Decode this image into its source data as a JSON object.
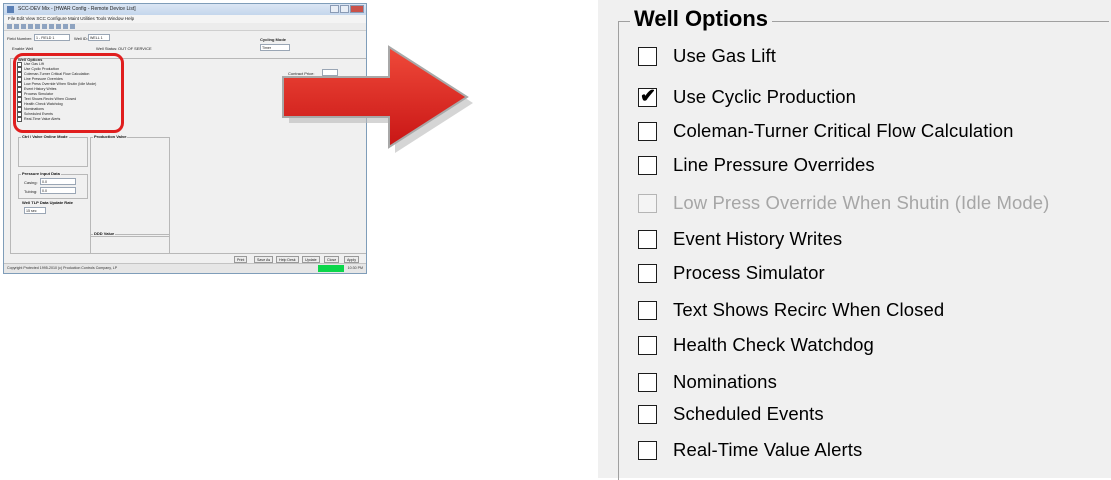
{
  "thumbnail": {
    "title": "SCC-DEV Mix - [HWAR Config - Remote Device List]",
    "menu": "File  Edit  View  SCC  Configure  Maint  Utilities  Tools  Window  Help",
    "fields": {
      "field_number_label": "Field Number:",
      "field_number_value": "1 - FIELD 1",
      "well_id_label": "Well ID:",
      "well_id_value": "WELL 1",
      "enable_label": "Enable Well",
      "well_status_label": "Well Status:",
      "well_status_value": "OUT OF SERVICE",
      "cycling_mode_label": "Cycling Mode",
      "cycling_mode_value": "Timer",
      "contract_label": "Contract Price:"
    },
    "well_options_label": "Well Options",
    "well_options": [
      "Use Gas Lift",
      "Use Cyclic Production",
      "Coleman-Turner Critical Flow Calculation",
      "Line Pressure Overrides",
      "Low Press Override When Shutin (Idle Mode)",
      "Event History Writes",
      "Process Simulator",
      "Text Shows Recirc When Closed",
      "Health Check Watchdog",
      "Nominations",
      "Scheduled Events",
      "Real-Time Value Alerts"
    ],
    "groups": {
      "valve_label": "Ctrl / Valve Online Mode",
      "production_label": "Production Valve",
      "pressure_label": "Pressure Input Data",
      "casing_label": "Casing:",
      "tubing_label": "Tubing:",
      "tlp_label": "Well TLP Data Update Rate",
      "tlp_value": "15 sec",
      "ddd_label": "DDD Value",
      "casing_value": "0.0",
      "tubing_value": "0.0"
    },
    "buttons": [
      "Print",
      "Save As",
      "Help Desk",
      "Update",
      "Close",
      "Apply"
    ],
    "status_text": "Copyright Protected 1995-2010 (c) Production Controls Company, LP",
    "status_time": "10:30 PM"
  },
  "well_options": {
    "title": "Well Options",
    "options": [
      {
        "label": "Use Gas Lift",
        "checked": false,
        "enabled": true
      },
      {
        "label": "Use Cyclic Production",
        "checked": true,
        "enabled": true
      },
      {
        "label": "Coleman-Turner Critical Flow Calculation",
        "checked": false,
        "enabled": true
      },
      {
        "label": "Line Pressure Overrides",
        "checked": false,
        "enabled": true
      },
      {
        "label": "Low Press Override When Shutin (Idle Mode)",
        "checked": false,
        "enabled": false
      },
      {
        "label": "Event History Writes",
        "checked": false,
        "enabled": true
      },
      {
        "label": "Process Simulator",
        "checked": false,
        "enabled": true
      },
      {
        "label": "Text Shows Recirc When Closed",
        "checked": false,
        "enabled": true
      },
      {
        "label": "Health Check Watchdog",
        "checked": false,
        "enabled": true
      },
      {
        "label": "Nominations",
        "checked": false,
        "enabled": true
      },
      {
        "label": "Scheduled Events",
        "checked": false,
        "enabled": true
      },
      {
        "label": "Real-Time Value Alerts",
        "checked": false,
        "enabled": true
      }
    ]
  },
  "colors": {
    "highlight": "#e01e1e",
    "arrow": "#e01e1e",
    "status_green": "#0bd64a"
  }
}
